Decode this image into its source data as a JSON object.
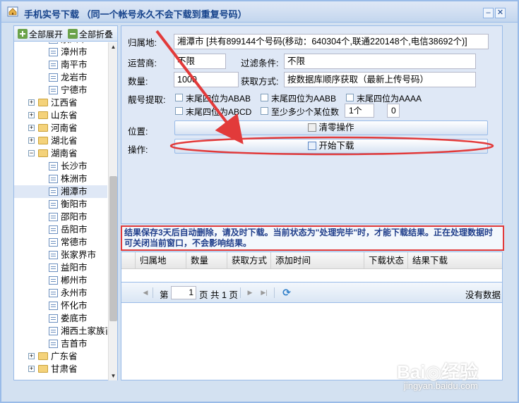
{
  "window": {
    "title": "手机实号下载 （同一个帐号永久不会下载到重复号码）",
    "min_glyph": "–",
    "close_glyph": "✕"
  },
  "tree": {
    "expand_all": "全部展开",
    "collapse_all": "全部折叠",
    "rows": [
      {
        "type": "leaf",
        "label": "泉州市",
        "indent": 2
      },
      {
        "type": "leaf",
        "label": "漳州市",
        "indent": 2
      },
      {
        "type": "leaf",
        "label": "南平市",
        "indent": 2
      },
      {
        "type": "leaf",
        "label": "龙岩市",
        "indent": 2
      },
      {
        "type": "leaf",
        "label": "宁德市",
        "indent": 2
      },
      {
        "type": "folder",
        "label": "江西省",
        "indent": 1,
        "state": "+"
      },
      {
        "type": "folder",
        "label": "山东省",
        "indent": 1,
        "state": "+"
      },
      {
        "type": "folder",
        "label": "河南省",
        "indent": 1,
        "state": "+"
      },
      {
        "type": "folder",
        "label": "湖北省",
        "indent": 1,
        "state": "+"
      },
      {
        "type": "folder",
        "label": "湖南省",
        "indent": 1,
        "state": "−"
      },
      {
        "type": "leaf",
        "label": "长沙市",
        "indent": 2
      },
      {
        "type": "leaf",
        "label": "株洲市",
        "indent": 2
      },
      {
        "type": "leaf",
        "label": "湘潭市",
        "indent": 2,
        "selected": true
      },
      {
        "type": "leaf",
        "label": "衡阳市",
        "indent": 2
      },
      {
        "type": "leaf",
        "label": "邵阳市",
        "indent": 2
      },
      {
        "type": "leaf",
        "label": "岳阳市",
        "indent": 2
      },
      {
        "type": "leaf",
        "label": "常德市",
        "indent": 2
      },
      {
        "type": "leaf",
        "label": "张家界市",
        "indent": 2
      },
      {
        "type": "leaf",
        "label": "益阳市",
        "indent": 2
      },
      {
        "type": "leaf",
        "label": "郴州市",
        "indent": 2
      },
      {
        "type": "leaf",
        "label": "永州市",
        "indent": 2
      },
      {
        "type": "leaf",
        "label": "怀化市",
        "indent": 2
      },
      {
        "type": "leaf",
        "label": "娄底市",
        "indent": 2
      },
      {
        "type": "leaf",
        "label": "湘西土家族苗",
        "indent": 2
      },
      {
        "type": "leaf",
        "label": "吉首市",
        "indent": 2
      },
      {
        "type": "folder",
        "label": "广东省",
        "indent": 1,
        "state": "+"
      },
      {
        "type": "folder",
        "label": "甘肃省",
        "indent": 1,
        "state": "+"
      }
    ]
  },
  "form": {
    "region_label": "归属地:",
    "region_value": "湘潭市 [共有899144个号码(移动：640304个,联通220148个,电信38692个)]",
    "carrier_label": "运营商:",
    "carrier_value": "不限",
    "filter_label": "过滤条件:",
    "filter_value": "不限",
    "quantity_label": "数量:",
    "quantity_value": "1000",
    "method_label": "获取方式:",
    "method_value": "按数据库顺序获取（最新上传号码）",
    "pretty_label": "靓号提取:",
    "checkboxes": {
      "abab": "末尾四位为ABAB",
      "aabb": "末尾四位为AABB",
      "aaaa": "末尾四位为AAAA",
      "abcd": "末尾四位为ABCD",
      "min_digits": "至少多少个某位数"
    },
    "spin_count": "1个",
    "spin_digit": "0",
    "position_label": "位置:",
    "clear_button": "清零操作",
    "action_label": "操作:",
    "download_button": "开始下载"
  },
  "notice": "结果保存3天后自动删除，请及时下载。当前状态为\"处理完毕\"时，才能下载结果。正在处理数据时可关闭当前窗口，不会影响结果。",
  "grid": {
    "columns": [
      "归属地",
      "数量",
      "获取方式",
      "添加时间",
      "下载状态",
      "结果下载"
    ]
  },
  "pager": {
    "page_prefix": "第",
    "page_value": "1",
    "page_suffix": "页 共 1 页",
    "empty_text": "没有数据"
  },
  "watermark": {
    "brand": "Bai◎经验",
    "url": "jingyan.baidu.com"
  },
  "colors": {
    "accent": "#15428b",
    "annotation": "#e23a3a"
  }
}
